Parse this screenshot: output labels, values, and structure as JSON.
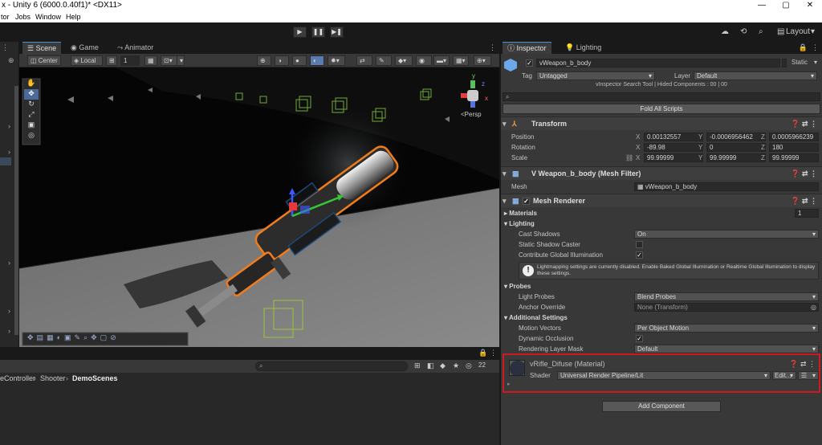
{
  "window": {
    "title": "x - Unity 6 (6000.0.40f1)* <DX11>",
    "controls": [
      "—",
      "▢",
      "✕"
    ]
  },
  "menu": [
    "tor",
    "Jobs",
    "Window",
    "Help"
  ],
  "toolbar": {
    "layout_label": "Layout",
    "play_icons": [
      "▶",
      "❚❚",
      "▶❚"
    ]
  },
  "scene_tabs": [
    {
      "label": "Scene",
      "active": true
    },
    {
      "label": "Game",
      "active": false
    },
    {
      "label": "Animator",
      "active": false
    }
  ],
  "scene_bar": {
    "pivot": "Center",
    "space": "Local",
    "snap_value": "1"
  },
  "viewport": {
    "persp_label": "<Persp",
    "gizmo_axes": {
      "y": "y",
      "z": "z",
      "x": "x"
    },
    "accent_orange": "#f07c1c",
    "accent_blue": "#4a90d9"
  },
  "bottom": {
    "breadcrumb": [
      "eController",
      "Shooter",
      "DemoScenes"
    ],
    "search_placeholder": "",
    "hidden_count": "22"
  },
  "inspector_tabs": [
    {
      "label": "Inspector",
      "active": true
    },
    {
      "label": "Lighting",
      "active": false
    }
  ],
  "inspector": {
    "object_name": "vWeapon_b_body",
    "static_label": "Static",
    "tag_label": "Tag",
    "tag_value": "Untagged",
    "layer_label": "Layer",
    "layer_value": "Default",
    "vinspector_note": "vInspector Search Tool | Hided Components : 00 | 00",
    "fold_all": "Fold All Scripts",
    "transform": {
      "title": "Transform",
      "position_label": "Position",
      "rotation_label": "Rotation",
      "scale_label": "Scale",
      "position": {
        "x": "0.00132557",
        "y": "-0.0006956462",
        "z": "0.0005966239"
      },
      "rotation": {
        "x": "-89.98",
        "y": "0",
        "z": "180"
      },
      "scale": {
        "x": "99.99999",
        "y": "99.99999",
        "z": "99.99999"
      }
    },
    "mesh_filter": {
      "title": "V Weapon_b_body (Mesh Filter)",
      "mesh_label": "Mesh",
      "mesh_value": "vWeapon_b_body"
    },
    "mesh_renderer": {
      "title": "Mesh Renderer",
      "materials_label": "Materials",
      "materials_count": "1",
      "lighting_label": "Lighting",
      "cast_shadows_label": "Cast Shadows",
      "cast_shadows_value": "On",
      "static_shadow_label": "Static Shadow Caster",
      "contribute_gi_label": "Contribute Global Illumination",
      "info_text": "Lightmapping settings are currently disabled. Enable Baked Global Illumination or Realtime Global Illumination to display these settings.",
      "probes_label": "Probes",
      "light_probes_label": "Light Probes",
      "light_probes_value": "Blend Probes",
      "anchor_label": "Anchor Override",
      "anchor_value": "None (Transform)",
      "additional_label": "Additional Settings",
      "motion_vectors_label": "Motion Vectors",
      "motion_vectors_value": "Per Object Motion",
      "dynamic_occlusion_label": "Dynamic Occlusion",
      "rendering_layer_label": "Rendering Layer Mask",
      "rendering_layer_value": "Default"
    },
    "material": {
      "title": "vRifle_Difuse (Material)",
      "shader_label": "Shader",
      "shader_value": "Universal Render Pipeline/Lit",
      "edit_label": "Edit...",
      "highlight_color": "#d0191f"
    },
    "add_component": "Add Component"
  }
}
